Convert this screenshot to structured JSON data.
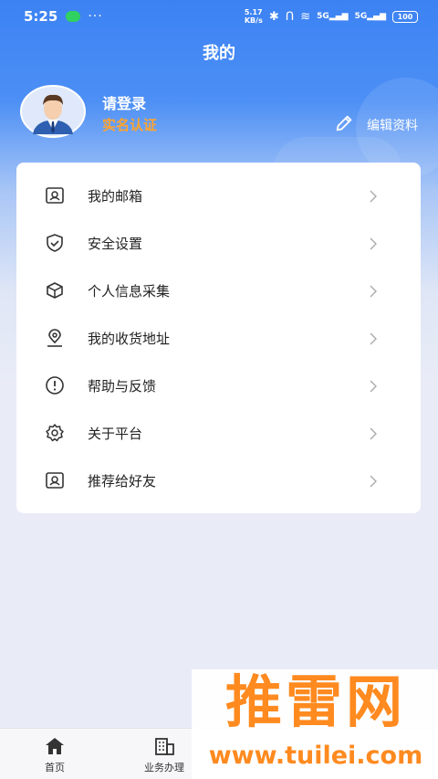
{
  "status": {
    "time": "5:25",
    "dots": "···",
    "net_speed_top": "5.17",
    "net_speed_bottom": "KB/s",
    "signal1": "5G",
    "signal2": "5G",
    "battery": "100"
  },
  "header": {
    "title": "我的"
  },
  "profile": {
    "name": "请登录",
    "verify": "实名认证",
    "edit_label": "编辑资料",
    "verify_color": "#ffa42e"
  },
  "menu": {
    "items": [
      {
        "label": "我的邮箱",
        "icon": "mailbox-icon"
      },
      {
        "label": "安全设置",
        "icon": "shield-icon"
      },
      {
        "label": "个人信息采集",
        "icon": "box-icon"
      },
      {
        "label": "我的收货地址",
        "icon": "location-pin-icon"
      },
      {
        "label": "帮助与反馈",
        "icon": "exclamation-circle-icon"
      },
      {
        "label": "关于平台",
        "icon": "gear-icon"
      },
      {
        "label": "推荐给好友",
        "icon": "share-card-icon"
      }
    ]
  },
  "tabbar": {
    "tabs": [
      {
        "label": "首页",
        "icon": "home-icon"
      },
      {
        "label": "业务办理",
        "icon": "building-icon"
      }
    ]
  },
  "watermark": {
    "big": "推雷网",
    "small": "www.tuilei.com"
  },
  "colors": {
    "primary": "#3c82f3",
    "accent": "#ffa42e",
    "watermark": "#ff8a1f"
  }
}
